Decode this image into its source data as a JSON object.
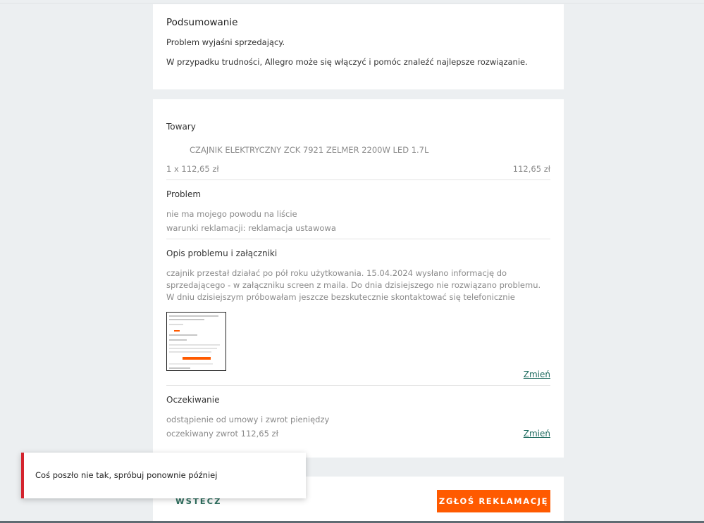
{
  "summary": {
    "title": "Podsumowanie",
    "line1": "Problem wyjaśni sprzedający.",
    "line2": "W przypadku trudności, Allegro może się włączyć i pomóc znaleźć najlepsze rozwiązanie."
  },
  "goods": {
    "title": "Towary",
    "product_name": "CZAJNIK ELEKTRYCZNY ZCK 7921 ZELMER 2200W LED 1.7L",
    "quantity_price": "1 x 112,65 zł",
    "total": "112,65 zł"
  },
  "problem": {
    "title": "Problem",
    "reason": "nie ma mojego powodu na liście",
    "conditions": "warunki reklamacji: reklamacja ustawowa"
  },
  "description": {
    "title": "Opis problemu i załączniki",
    "lines": [
      "czajnik przestał działać po pół roku użytkowania. 15.04.2024 wysłano informację do",
      "sprzedającego - w załączniku screen z maila. Do dnia dzisiejszego nie rozwiązano problemu.",
      "W dniu dzisiejszym próbowałam jeszcze bezskutecznie skontaktować się telefonicznie"
    ],
    "change_label": "Zmień"
  },
  "expectation": {
    "title": "Oczekiwanie",
    "line1": "odstąpienie od umowy i zwrot pieniędzy",
    "line2": "oczekiwany zwrot 112,65 zł",
    "change_label": "Zmień"
  },
  "actions": {
    "back_label": "WSTECZ",
    "submit_label": "ZGŁOŚ REKLAMACJĘ"
  },
  "toast": {
    "message": "Coś poszło nie tak, spróbuj ponownie później",
    "accent_color": "#d4242e"
  },
  "colors": {
    "primary_button": "#ff5a00",
    "link": "#1d6b5f",
    "page_background": "#eceff1"
  }
}
